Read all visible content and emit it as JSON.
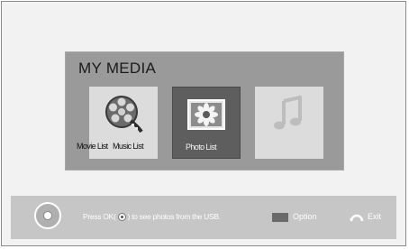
{
  "panel": {
    "title": "MY MEDIA",
    "tiles": [
      {
        "label": "Movie List",
        "icon": "film-reel-icon",
        "selected": false
      },
      {
        "label": "Music List",
        "icon": "music-note-icon",
        "selected": false
      },
      {
        "label": "Photo List",
        "icon": "photo-flower-icon",
        "selected": true
      }
    ]
  },
  "bottom_bar": {
    "hint_before": "Press OK(",
    "hint_after": ") to see photos from the USB.",
    "option_label": "Option",
    "exit_label": "Exit"
  },
  "colors": {
    "panel_bg": "#9a9a9a",
    "tile_bg": "#dcdcdc",
    "selected_tile_bg": "#5e5e5e",
    "bottom_bar_bg": "#c6c6c6"
  }
}
